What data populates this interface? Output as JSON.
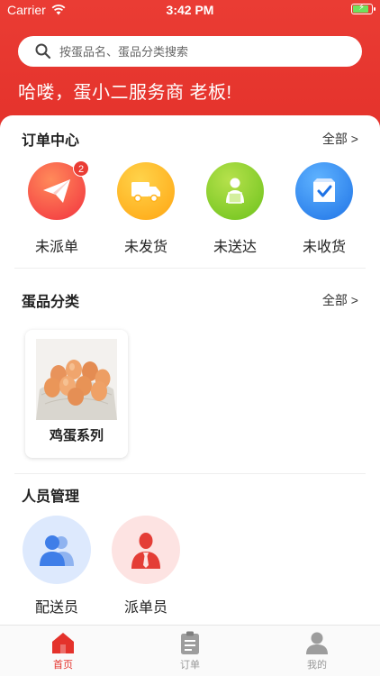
{
  "status_bar": {
    "carrier": "Carrier",
    "time": "3:42 PM"
  },
  "search": {
    "placeholder": "按蛋品名、蛋品分类搜索"
  },
  "greeting": "哈喽，蛋小二服务商 老板!",
  "orders": {
    "title": "订单中心",
    "more": "全部 >",
    "items": [
      {
        "label": "未派单",
        "icon": "paper-plane-icon",
        "badge": "2",
        "color": "#ff4b3a"
      },
      {
        "label": "未发货",
        "icon": "delivery-truck-icon",
        "color": "#ffb21c"
      },
      {
        "label": "未送达",
        "icon": "courier-package-icon",
        "color": "#8ad033"
      },
      {
        "label": "未收货",
        "icon": "box-check-icon",
        "color": "#2f86f0"
      }
    ]
  },
  "categories": {
    "title": "蛋品分类",
    "more": "全部 >",
    "items": [
      {
        "label": "鸡蛋系列",
        "icon": "eggs-photo"
      }
    ]
  },
  "staff": {
    "title": "人员管理",
    "items": [
      {
        "label": "配送员",
        "icon": "delivery-people-icon",
        "color": "#dde9fd"
      },
      {
        "label": "派单员",
        "icon": "dispatcher-person-icon",
        "color": "#fde3e2"
      }
    ]
  },
  "tabbar": {
    "accent": "#e4322b",
    "items": [
      {
        "label": "首页",
        "icon": "home-icon",
        "active": true
      },
      {
        "label": "订单",
        "icon": "clipboard-icon",
        "active": false
      },
      {
        "label": "我的",
        "icon": "user-icon",
        "active": false
      }
    ]
  }
}
